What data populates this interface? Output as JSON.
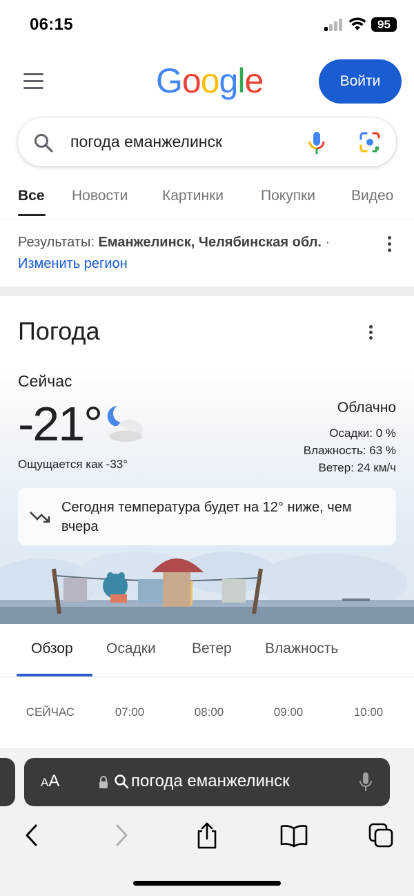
{
  "status_bar": {
    "time": "06:15",
    "battery": "95"
  },
  "header": {
    "logo_letters": [
      {
        "ch": "G",
        "color": "#4285F4"
      },
      {
        "ch": "o",
        "color": "#EA4335"
      },
      {
        "ch": "o",
        "color": "#FBBC05"
      },
      {
        "ch": "g",
        "color": "#4285F4"
      },
      {
        "ch": "l",
        "color": "#34A853"
      },
      {
        "ch": "e",
        "color": "#EA4335"
      }
    ],
    "signin_label": "Войти"
  },
  "search": {
    "query": "погода еманжелинск"
  },
  "tabs": [
    "Все",
    "Новости",
    "Картинки",
    "Покупки",
    "Видео"
  ],
  "region": {
    "prefix": "Результаты: ",
    "location": "Еманжелинск, Челябинская обл.",
    "suffix": " ·",
    "change_link": "Изменить регион"
  },
  "weather": {
    "title": "Погода",
    "now_label": "Сейчас",
    "temperature": "-21°",
    "feels_like": "Ощущается как -33°",
    "condition": "Облачно",
    "precipitation": "Осадки: 0 %",
    "humidity": "Влажность: 63 %",
    "wind": "Ветер: 24 км/ч",
    "note": "Сегодня температура будет на 12° ниже, чем вчера"
  },
  "forecast_tabs": [
    "Обзор",
    "Осадки",
    "Ветер",
    "Влажность"
  ],
  "hours": [
    "СЕЙЧАС",
    "07:00",
    "08:00",
    "09:00",
    "10:00"
  ],
  "safari": {
    "aa_label": "AA",
    "url_text": "погода еманжелинск"
  },
  "colors": {
    "signin_button": "#1a5cd1",
    "link": "#1558d6",
    "active_tab_underline": "#2b5bc7"
  }
}
